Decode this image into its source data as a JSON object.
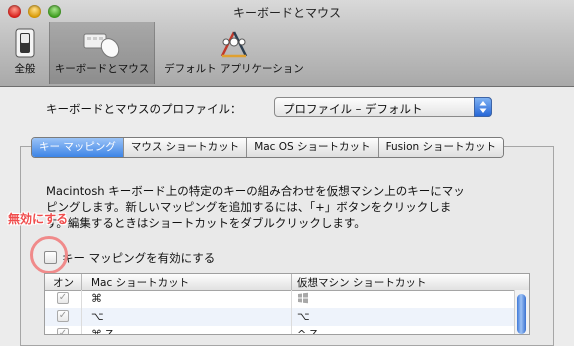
{
  "window": {
    "title": "キーボードとマウス"
  },
  "toolbar": {
    "items": [
      {
        "label": "全般",
        "icon": "general-switch-icon"
      },
      {
        "label": "キーボードとマウス",
        "icon": "keyboard-mouse-icon",
        "selected": true
      },
      {
        "label": "デフォルト アプリケーション",
        "icon": "default-apps-icon"
      }
    ]
  },
  "profile": {
    "label": "キーボードとマウスのプロファイル：",
    "selected": "プロファイル – デフォルト"
  },
  "tabs": [
    {
      "label": "キー マッピング",
      "selected": true
    },
    {
      "label": "マウス ショートカット"
    },
    {
      "label": "Mac OS ショートカット"
    },
    {
      "label": "Fusion ショートカット"
    }
  ],
  "description": {
    "lines": [
      "Macintosh キーボード上の特定のキーの組み合わせを仮想マシン上のキーにマッ",
      "ピングします。新しいマッピングを追加するには、「+」ボタンをクリックしま",
      "す。編集するときはショートカットをダブルクリックします。"
    ]
  },
  "enable_mapping": {
    "label": "キー マッピングを有効にする",
    "checked": false
  },
  "annotation": {
    "text": "無効にする",
    "color": "#f04c4c"
  },
  "table": {
    "headers": {
      "on": "オン",
      "mac": "Mac ショートカット",
      "vm": "仮想マシン ショートカット"
    },
    "rows": [
      {
        "on": true,
        "mac": "⌘",
        "vm": "⊞"
      },
      {
        "on": true,
        "mac": "⌥",
        "vm": "⌥"
      },
      {
        "on": true,
        "mac": "⌘ Z",
        "vm": "^ Z"
      }
    ]
  },
  "colors": {
    "selected_tab": "#3d84e6",
    "annotation": "#f04c4c"
  }
}
